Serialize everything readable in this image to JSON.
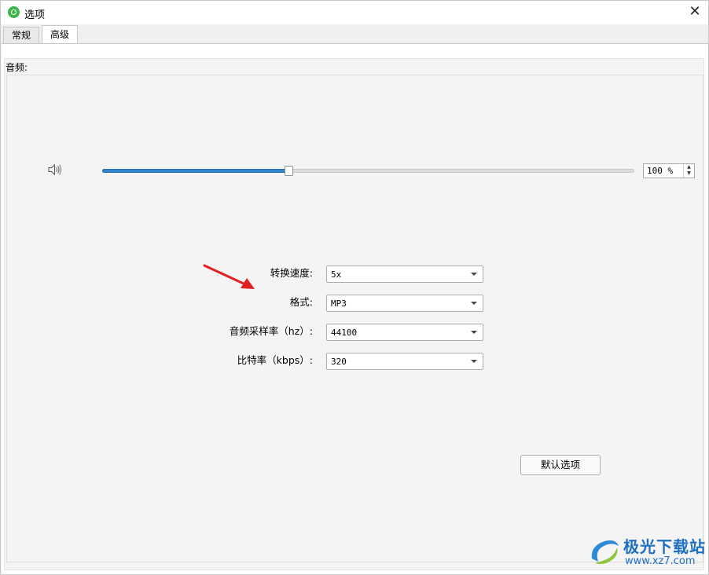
{
  "window": {
    "title": "选项",
    "close_symbol": "✕"
  },
  "tabs": [
    {
      "label": "常规",
      "active": false
    },
    {
      "label": "高级",
      "active": true
    }
  ],
  "audio_group": {
    "title": "音频:"
  },
  "volume": {
    "value_percent": 35,
    "spin_text": "100 %",
    "icon": "speaker-icon"
  },
  "form": {
    "speed": {
      "label": "转换速度:",
      "value": "5x"
    },
    "format": {
      "label": "格式:",
      "value": "MP3"
    },
    "sample_rate": {
      "label": "音频采样率（hz）:",
      "value": "44100"
    },
    "bitrate": {
      "label": "比特率（kbps）:",
      "value": "320"
    }
  },
  "default_button": {
    "label": "默认选项"
  },
  "annotation": {
    "arrow_color": "#e02020"
  },
  "watermark": {
    "title": "极光下载站",
    "url": "www.xz7.com"
  },
  "colors": {
    "accent": "#2f86cf",
    "app_icon": "#3cb54a"
  }
}
